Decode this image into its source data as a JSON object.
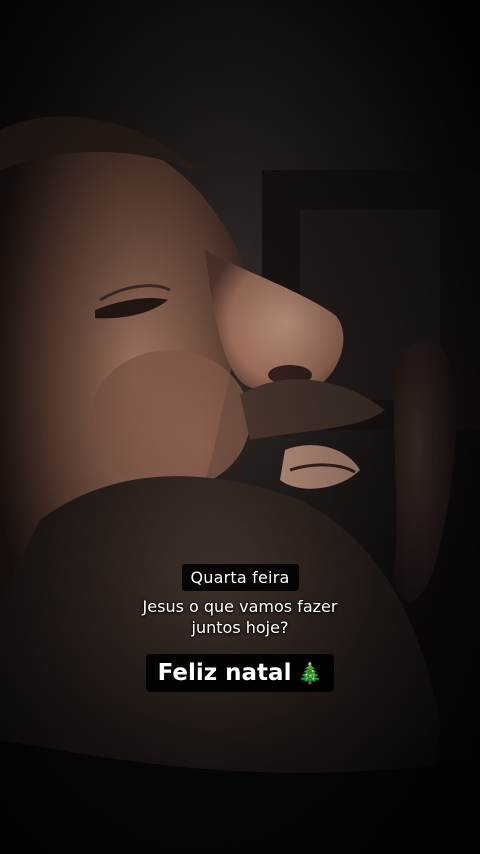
{
  "captions": {
    "day_label": "Quarta feira",
    "question_line1": "Jesus o que vamos fazer",
    "question_line2": "juntos hoje?",
    "greeting": "Feliz natal"
  },
  "icons": {
    "greeting_emoji": "christmas-tree-icon"
  },
  "colors": {
    "background": "#0d0b0a",
    "skin_highlight": "#d7a286",
    "caption_bg": "#000000",
    "caption_text": "#ffffff"
  }
}
